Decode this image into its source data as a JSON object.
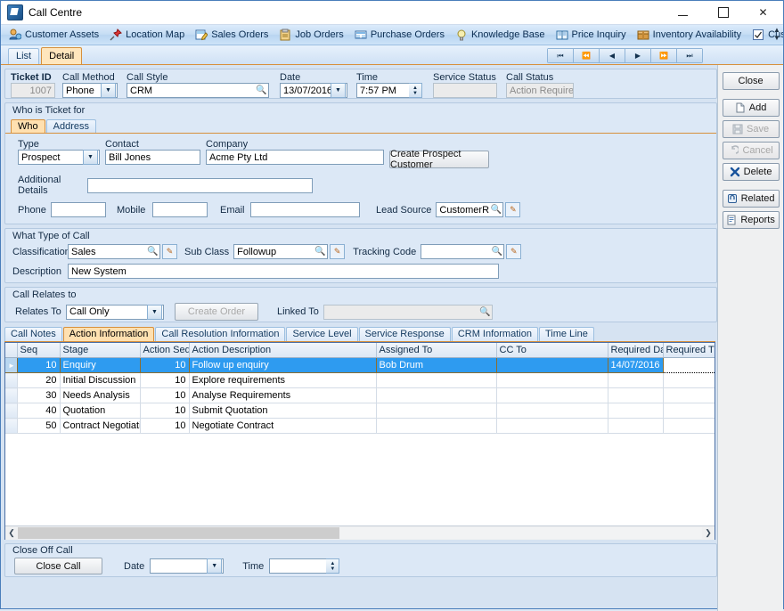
{
  "window": {
    "title": "Call Centre",
    "app_icon": "app-icon",
    "minimize": "—",
    "maximize": "❐",
    "close": "✕"
  },
  "nav": {
    "items": [
      {
        "label": "Customer Assets",
        "icon": "customer-assets-icon"
      },
      {
        "label": "Location Map",
        "icon": "pushpin-icon"
      },
      {
        "label": "Sales Orders",
        "icon": "sales-orders-icon"
      },
      {
        "label": "Job Orders",
        "icon": "clipboard-icon"
      },
      {
        "label": "Purchase Orders",
        "icon": "purchase-orders-icon"
      },
      {
        "label": "Knowledge Base",
        "icon": "lightbulb-icon"
      },
      {
        "label": "Price Inquiry",
        "icon": "book-icon"
      },
      {
        "label": "Inventory Availability",
        "icon": "box-icon"
      },
      {
        "label": "Customise",
        "icon": "checkbox-icon"
      }
    ]
  },
  "page_tabs": [
    {
      "label": "List",
      "active": false
    },
    {
      "label": "Detail",
      "active": true
    }
  ],
  "record_nav": [
    {
      "name": "first-record",
      "glyph": "⏮"
    },
    {
      "name": "prev-page",
      "glyph": "⏪"
    },
    {
      "name": "prev-record",
      "glyph": "◀"
    },
    {
      "name": "next-record",
      "glyph": "▶"
    },
    {
      "name": "next-page",
      "glyph": "⏩"
    },
    {
      "name": "last-record",
      "glyph": "⏭"
    }
  ],
  "header": {
    "ticket_id_label": "Ticket ID",
    "ticket_id_value": "1007",
    "call_method_label": "Call Method",
    "call_method_value": "Phone",
    "call_style_label": "Call Style",
    "call_style_value": "CRM",
    "date_label": "Date",
    "date_value": "13/07/2016",
    "time_label": "Time",
    "time_value": "7:57 PM",
    "service_status_label": "Service Status",
    "service_status_value": "",
    "call_status_label": "Call Status",
    "call_status_value": "Action Required"
  },
  "who_group": {
    "title": "Who is Ticket for",
    "tabs": [
      {
        "label": "Who",
        "active": true
      },
      {
        "label": "Address",
        "active": false
      }
    ],
    "type_label": "Type",
    "type_value": "Prospect",
    "contact_label": "Contact",
    "contact_value": "Bill Jones",
    "company_label": "Company",
    "company_value": "Acme Pty Ltd",
    "create_prospect_button": "Create Prospect Customer",
    "additional_details_label": "Additional Details",
    "additional_details_value": "",
    "phone_label": "Phone",
    "phone_value": "",
    "mobile_label": "Mobile",
    "mobile_value": "",
    "email_label": "Email",
    "email_value": "",
    "lead_source_label": "Lead Source",
    "lead_source_value": "CustomerReferral"
  },
  "call_type_group": {
    "title": "What Type of Call",
    "classification_label": "Classification",
    "classification_value": "Sales",
    "sub_class_label": "Sub Class",
    "sub_class_value": "Followup",
    "tracking_code_label": "Tracking Code",
    "tracking_code_value": "",
    "description_label": "Description",
    "description_value": "New System"
  },
  "relates_group": {
    "title": "Call Relates to",
    "relates_to_label": "Relates To",
    "relates_to_value": "Call Only",
    "create_order_button": "Create Order",
    "linked_to_label": "Linked To",
    "linked_to_value": ""
  },
  "grid_tabs": [
    {
      "label": "Call Notes",
      "active": false
    },
    {
      "label": "Action Information",
      "active": true
    },
    {
      "label": "Call Resolution Information",
      "active": false
    },
    {
      "label": "Service Level",
      "active": false
    },
    {
      "label": "Service Response",
      "active": false
    },
    {
      "label": "CRM Information",
      "active": false
    },
    {
      "label": "Time Line",
      "active": false
    }
  ],
  "grid": {
    "columns": [
      "Seq",
      "Stage",
      "Action Seq",
      "Action Description",
      "Assigned To",
      "CC To",
      "Required Date",
      "Required Time"
    ],
    "rows": [
      {
        "selected": true,
        "seq": "10",
        "stage": "Enquiry",
        "action_seq": "10",
        "action_description": "Follow up enquiry",
        "assigned_to": "Bob Drum",
        "cc_to": "",
        "required_date": "14/07/2016",
        "required_time": ""
      },
      {
        "selected": false,
        "seq": "20",
        "stage": "Initial Discussion",
        "action_seq": "10",
        "action_description": "Explore requirements",
        "assigned_to": "",
        "cc_to": "",
        "required_date": "",
        "required_time": ""
      },
      {
        "selected": false,
        "seq": "30",
        "stage": "Needs Analysis",
        "action_seq": "10",
        "action_description": "Analyse Requirements",
        "assigned_to": "",
        "cc_to": "",
        "required_date": "",
        "required_time": ""
      },
      {
        "selected": false,
        "seq": "40",
        "stage": "Quotation",
        "action_seq": "10",
        "action_description": "Submit Quotation",
        "assigned_to": "",
        "cc_to": "",
        "required_date": "",
        "required_time": ""
      },
      {
        "selected": false,
        "seq": "50",
        "stage": "Contract Negotiation",
        "action_seq": "10",
        "action_description": "Negotiate Contract",
        "assigned_to": "",
        "cc_to": "",
        "required_date": "",
        "required_time": ""
      }
    ]
  },
  "close_off": {
    "title": "Close Off Call",
    "close_call_button": "Close Call",
    "date_label": "Date",
    "date_value": "",
    "time_label": "Time",
    "time_value": ""
  },
  "sidebar": {
    "buttons": [
      {
        "label": "Close",
        "icon": "",
        "disabled": false
      },
      {
        "label": "Add",
        "icon": "page-icon",
        "disabled": false
      },
      {
        "label": "Save",
        "icon": "floppy-icon",
        "disabled": true
      },
      {
        "label": "Cancel",
        "icon": "undo-icon",
        "disabled": true
      },
      {
        "label": "Delete",
        "icon": "x-cross-icon",
        "disabled": false
      },
      {
        "label": "Related",
        "icon": "link-icon",
        "disabled": false
      },
      {
        "label": "Reports",
        "icon": "report-icon",
        "disabled": false
      }
    ]
  },
  "colors": {
    "accent": "#2e9bf0",
    "tab_active": "#ffe0b0",
    "panel": "#dce8f6",
    "window_bg": "#d6e3f2",
    "border": "#4a7ebb"
  }
}
